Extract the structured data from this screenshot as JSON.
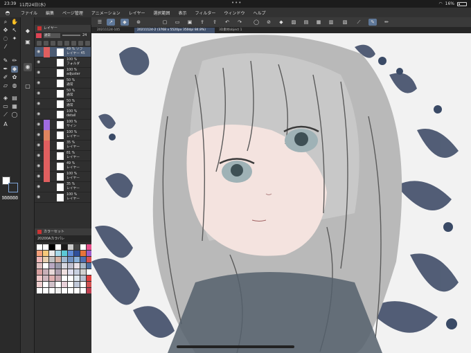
{
  "status": {
    "time": "23:39",
    "date": "11月24日(水)",
    "battery": "16%"
  },
  "menu": {
    "items": [
      "ファイル",
      "編集",
      "ページ管理",
      "アニメーション",
      "レイヤー",
      "選択範囲",
      "表示",
      "フィルター",
      "ウィンドウ",
      "ヘルプ"
    ]
  },
  "tabs": {
    "tab1": "20211124-105",
    "tab2": "20211124-2 (3768 x 5520px 350dpi 84.8%)",
    "tab3": "3D素材object 1"
  },
  "layer_panel": {
    "title": "レイヤー",
    "blend_mode": "通常",
    "opacity": "24",
    "layers": [
      {
        "line1": "49 % ソフ",
        "line2": "レイヤー 45",
        "color": "#e05f5f",
        "selected": true
      },
      {
        "line1": "100 %",
        "line2": "フォルダ",
        "color": "",
        "selected": false
      },
      {
        "line1": "100 %",
        "line2": "adjuster",
        "color": "",
        "selected": false
      },
      {
        "line1": "50 %",
        "line2": "通常",
        "color": "",
        "selected": false
      },
      {
        "line1": "50 %",
        "line2": "通常",
        "color": "",
        "selected": false
      },
      {
        "line1": "50 %",
        "line2": "通常",
        "color": "",
        "selected": false
      },
      {
        "line1": "100 %",
        "line2": "detail",
        "color": "",
        "selected": false
      },
      {
        "line1": "100 %",
        "line2": "サイン",
        "color": "#a06be0",
        "selected": false
      },
      {
        "line1": "100 %",
        "line2": "レイヤー",
        "color": "#e0855f",
        "selected": false
      },
      {
        "line1": "35 %",
        "line2": "レイヤー",
        "color": "#e05f5f",
        "selected": false
      },
      {
        "line1": "81 %",
        "line2": "レイヤー",
        "color": "#e05f5f",
        "selected": false
      },
      {
        "line1": "49 %",
        "line2": "レイヤー",
        "color": "#e05f5f",
        "selected": false
      },
      {
        "line1": "100 %",
        "line2": "レイヤー",
        "color": "#e05f5f",
        "selected": false
      },
      {
        "line1": "35 %",
        "line2": "レイヤー",
        "color": "",
        "selected": false
      },
      {
        "line1": "100 %",
        "line2": "レイヤー",
        "color": "",
        "selected": false
      }
    ]
  },
  "color_panel": {
    "title": "カラーセット",
    "set_name": "20200Aカラパレ",
    "colors": [
      "#ffffff",
      "#ffffff",
      "#000000",
      "#ffffff",
      "#1a1a1a",
      "#cccccc",
      "#444444",
      "#ffffff",
      "#e84e8a",
      "#f6a07a",
      "#f7c97a",
      "#eaeaea",
      "#a7d8e8",
      "#5bc9d6",
      "#5f8ad6",
      "#2f4f9a",
      "#e8743a",
      "#9e5cc9",
      "#f0b8b8",
      "#e8d0b0",
      "#c0c0c0",
      "#d6b0a0",
      "#a0b8d0",
      "#7090c0",
      "#8ab0d8",
      "#4f6fb0",
      "#d85050",
      "#e0c0c0",
      "#ffffff",
      "#b8a8c0",
      "#9898a8",
      "#d8d8e0",
      "#c0c0d0",
      "#e8e0e8",
      "#a8b8c8",
      "#5070a0",
      "#d8a0a0",
      "#c8b0b8",
      "#e8d8d8",
      "#b0a0b0",
      "#f0e0e0",
      "#e0e0f0",
      "#c8d0e0",
      "#d0d0d0",
      "#ffffff",
      "#f0c8c8",
      "#d0b8c0",
      "#e0b0b0",
      "#c8a8b0",
      "#ffffff",
      "#ffffff",
      "#e0e8f0",
      "#b8c0d0",
      "#e04040",
      "#f0d0d0",
      "#ffffff",
      "#d0c0c8",
      "#ffffff",
      "#e8d0d8",
      "#ffffff",
      "#c0c8d8",
      "#ffffff",
      "#d05050",
      "#ffffff",
      "#ffffff",
      "#ffffff",
      "#f0f0f0",
      "#ffffff",
      "#ffffff",
      "#ffffff",
      "#ffffff",
      "#c04050"
    ]
  },
  "colors": {
    "accent": "#5f7899",
    "canvas_bg": "#f2f2f2"
  }
}
